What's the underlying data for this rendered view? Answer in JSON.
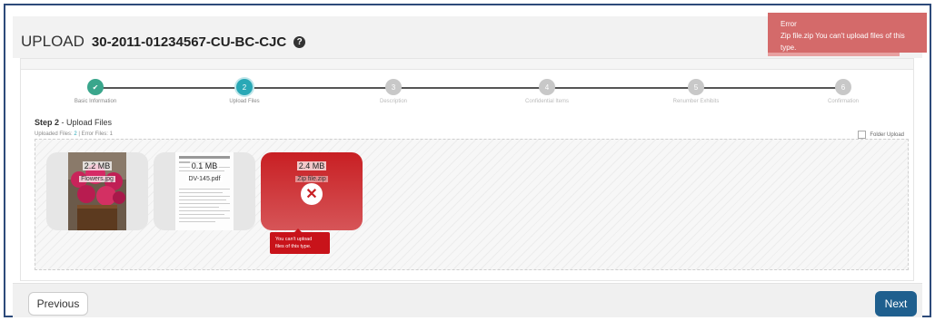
{
  "header": {
    "upload_label": "UPLOAD",
    "case_number": "30-2011-01234567-CU-BC-CJC",
    "help_icon": "?"
  },
  "toast": {
    "title": "Error",
    "message": "Zip file.zip You can't upload files of this type.",
    "color": "#d46a6a"
  },
  "stepper": {
    "steps": [
      {
        "number": "✔",
        "label": "Basic Information",
        "state": "done"
      },
      {
        "number": "2",
        "label": "Upload Files",
        "state": "active"
      },
      {
        "number": "3",
        "label": "Description",
        "state": "pending"
      },
      {
        "number": "4",
        "label": "Confidential Items",
        "state": "pending"
      },
      {
        "number": "5",
        "label": "Renumber Exhibits",
        "state": "pending"
      },
      {
        "number": "6",
        "label": "Confirmation",
        "state": "pending"
      }
    ]
  },
  "step_heading": {
    "step": "Step 2",
    "separator": " - ",
    "name": "Upload Files"
  },
  "counts": {
    "uploaded_label": "Uploaded Files:",
    "uploaded_value": "2",
    "separator": " | ",
    "error_label": "Error Files:",
    "error_value": "1"
  },
  "folder_upload": {
    "label": "Folder Upload",
    "checked": false
  },
  "files": [
    {
      "size": "2.2 MB",
      "name": "Flowers.jpg",
      "status": "ok"
    },
    {
      "size": "0.1 MB",
      "name": "DV-145.pdf",
      "status": "ok"
    },
    {
      "size": "2.4 MB",
      "name": "Zip file.zip",
      "status": "error"
    }
  ],
  "tooltip": {
    "line1": "You can't upload",
    "line2": "files of this type."
  },
  "footer": {
    "previous_label": "Previous",
    "next_label": "Next"
  },
  "colors": {
    "accent": "#29a8b6",
    "done": "#3aa68c",
    "error": "#c8131a",
    "next_button": "#1f5f8e"
  }
}
